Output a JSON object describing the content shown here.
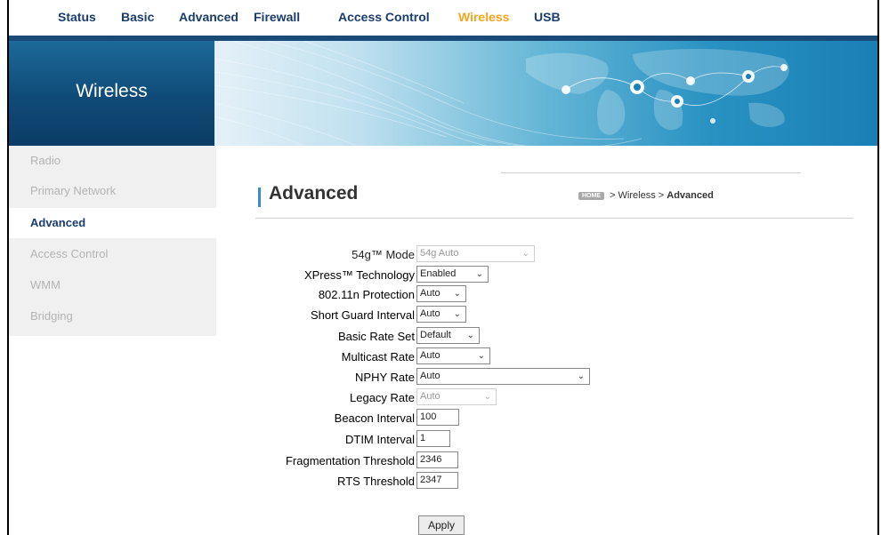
{
  "topnav": {
    "items": [
      {
        "label": "Status"
      },
      {
        "label": "Basic"
      },
      {
        "label": "Advanced"
      },
      {
        "label": "Firewall"
      },
      {
        "label": "Access Control"
      },
      {
        "label": "Wireless"
      },
      {
        "label": "USB"
      }
    ],
    "active": "Wireless",
    "active_color": "#f7a51c",
    "text_color": "#1a3c6e"
  },
  "banner": {
    "title": "Wireless"
  },
  "sidebar": {
    "items": [
      {
        "label": "Radio"
      },
      {
        "label": "Primary Network"
      },
      {
        "label": "Advanced"
      },
      {
        "label": "Access Control"
      },
      {
        "label": "WMM"
      },
      {
        "label": "Bridging"
      }
    ],
    "active": "Advanced"
  },
  "page": {
    "title": "Advanced",
    "breadcrumb": {
      "home_label": "HOME",
      "path": "> Wireless >",
      "current": "Advanced"
    }
  },
  "form": {
    "mode_54g": {
      "label": "54g™ Mode",
      "value": "54g Auto",
      "disabled": true
    },
    "xpress": {
      "label": "XPress™ Technology",
      "value": "Enabled"
    },
    "protection": {
      "label": "802.11n Protection",
      "value": "Auto"
    },
    "guard_interval": {
      "label": "Short Guard Interval",
      "value": "Auto"
    },
    "basic_rate": {
      "label": "Basic Rate Set",
      "value": "Default"
    },
    "multicast_rate": {
      "label": "Multicast Rate",
      "value": "Auto"
    },
    "nphy_rate": {
      "label": "NPHY Rate",
      "value": "Auto"
    },
    "legacy_rate": {
      "label": "Legacy Rate",
      "value": "Auto",
      "disabled": true
    },
    "beacon_interval": {
      "label": "Beacon Interval",
      "value": "100"
    },
    "dtim_interval": {
      "label": "DTIM Interval",
      "value": "1"
    },
    "frag_threshold": {
      "label": "Fragmentation Threshold",
      "value": "2346"
    },
    "rts_threshold": {
      "label": "RTS Threshold",
      "value": "2347"
    },
    "apply_label": "Apply"
  }
}
